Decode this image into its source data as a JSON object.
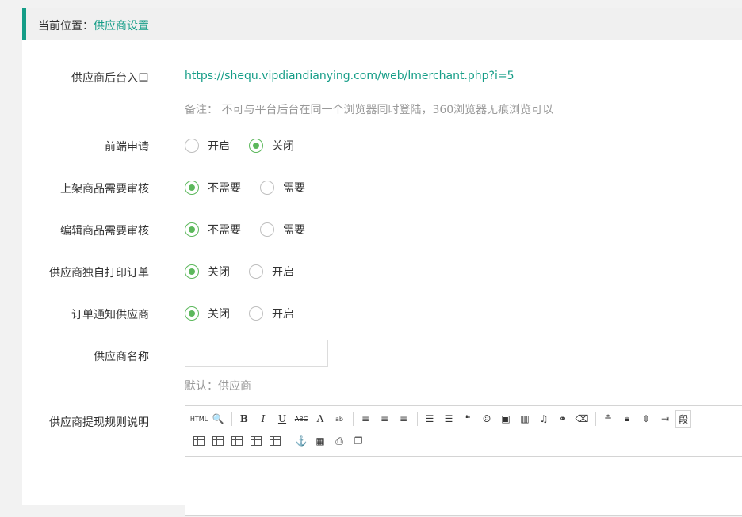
{
  "breadcrumb": {
    "prefix": "当前位置：",
    "current": "供应商设置"
  },
  "form": {
    "entry": {
      "label": "供应商后台入口",
      "url": "https://shequ.vipdiandianying.com/web/lmerchant.php?i=5",
      "note": "备注：  不可与平台后台在同一个浏览器同时登陆，360浏览器无痕浏览可以"
    },
    "frontend_apply": {
      "label": "前端申请",
      "options": [
        {
          "text": "开启",
          "checked": false
        },
        {
          "text": "关闭",
          "checked": true
        }
      ]
    },
    "listing_review": {
      "label": "上架商品需要审核",
      "options": [
        {
          "text": "不需要",
          "checked": true
        },
        {
          "text": "需要",
          "checked": false
        }
      ]
    },
    "edit_review": {
      "label": "编辑商品需要审核",
      "options": [
        {
          "text": "不需要",
          "checked": true
        },
        {
          "text": "需要",
          "checked": false
        }
      ]
    },
    "independent_print": {
      "label": "供应商独自打印订单",
      "options": [
        {
          "text": "关闭",
          "checked": true
        },
        {
          "text": "开启",
          "checked": false
        }
      ]
    },
    "order_notify": {
      "label": "订单通知供应商",
      "options": [
        {
          "text": "关闭",
          "checked": true
        },
        {
          "text": "开启",
          "checked": false
        }
      ]
    },
    "supplier_name": {
      "label": "供应商名称",
      "value": "",
      "placeholder": "",
      "hint": "默认：供应商"
    },
    "withdraw_rules": {
      "label": "供应商提现规则说明",
      "toolbar_row1": [
        "html",
        "preview-icon",
        "bold",
        "italic",
        "underline",
        "strikethrough",
        "font-color",
        "highlight",
        "align-left",
        "align-center",
        "align-right",
        "ordered-list",
        "unordered-list",
        "blockquote",
        "emoji",
        "image",
        "video",
        "music",
        "link",
        "eraser",
        "row-spacing",
        "valign",
        "line-height",
        "indent",
        "paragraph"
      ],
      "toolbar_row2": [
        "table-insert",
        "table-row",
        "table-col",
        "table-merge",
        "table-split",
        "anchor",
        "template",
        "print",
        "preview"
      ],
      "labels": {
        "html": "HTML",
        "bold": "B",
        "italic": "I",
        "underline": "U",
        "strike": "ABC",
        "font": "A",
        "highlight": "ab",
        "quote": "❝",
        "emoji": "☺",
        "para": "段"
      }
    }
  }
}
